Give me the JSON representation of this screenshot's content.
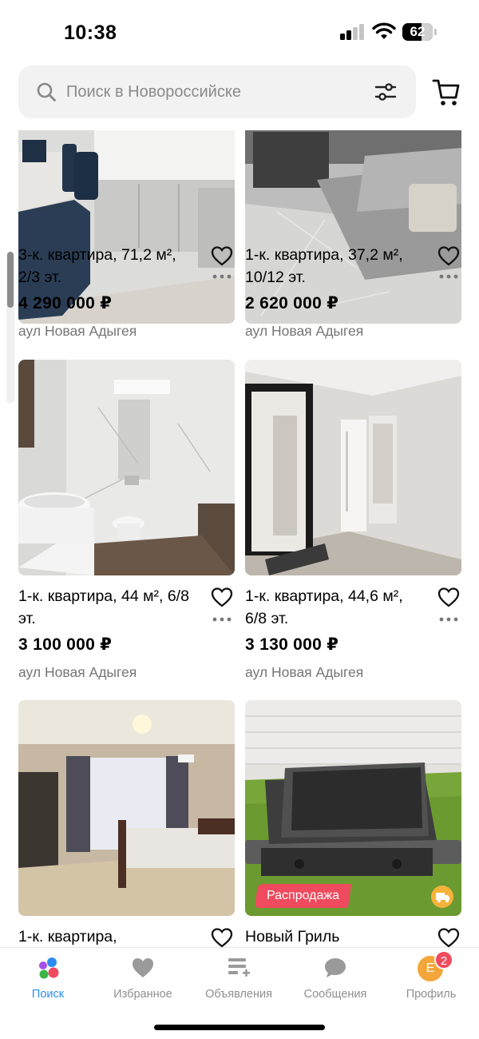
{
  "status": {
    "time": "10:38",
    "battery": "62"
  },
  "search": {
    "placeholder": "Поиск в Новороссийске"
  },
  "listings": [
    {
      "title": "3-к. квартира, 71,2 м², 2/3 эт.",
      "price": "4 290 000 ₽",
      "location": "аул Новая Адыгея",
      "photo": "kitchen-photo"
    },
    {
      "title": "1-к. квартира, 37,2 м², 10/12 эт.",
      "price": "2 620 000 ₽",
      "location": "аул Новая Адыгея",
      "photo": "living-room-photo"
    },
    {
      "title": "1-к. квартира, 44 м², 6/8 эт.",
      "price": "3 100 000 ₽",
      "location": "аул Новая Адыгея",
      "photo": "bathroom-photo"
    },
    {
      "title": "1-к. квартира, 44,6 м², 6/8 эт.",
      "price": "3 130 000 ₽",
      "location": "аул Новая Адыгея",
      "photo": "hallway-photo"
    },
    {
      "title": "1-к. квартира,",
      "photo": "bedroom-photo"
    },
    {
      "title": "Новый Гриль",
      "photo": "grill-photo",
      "badge": "Распродажа"
    }
  ],
  "nav": {
    "items": [
      {
        "label": "Поиск",
        "icon": "search-logo-icon",
        "active": true
      },
      {
        "label": "Избранное",
        "icon": "heart-icon"
      },
      {
        "label": "Объявления",
        "icon": "listings-icon"
      },
      {
        "label": "Сообщения",
        "icon": "chat-icon"
      },
      {
        "label": "Профиль",
        "icon": "avatar-icon",
        "avatar_letter": "E",
        "badge_count": "2"
      }
    ]
  },
  "colors": {
    "accent": "#2d8cf0",
    "sale": "#ef4a5d",
    "avatar": "#f4a63a"
  }
}
